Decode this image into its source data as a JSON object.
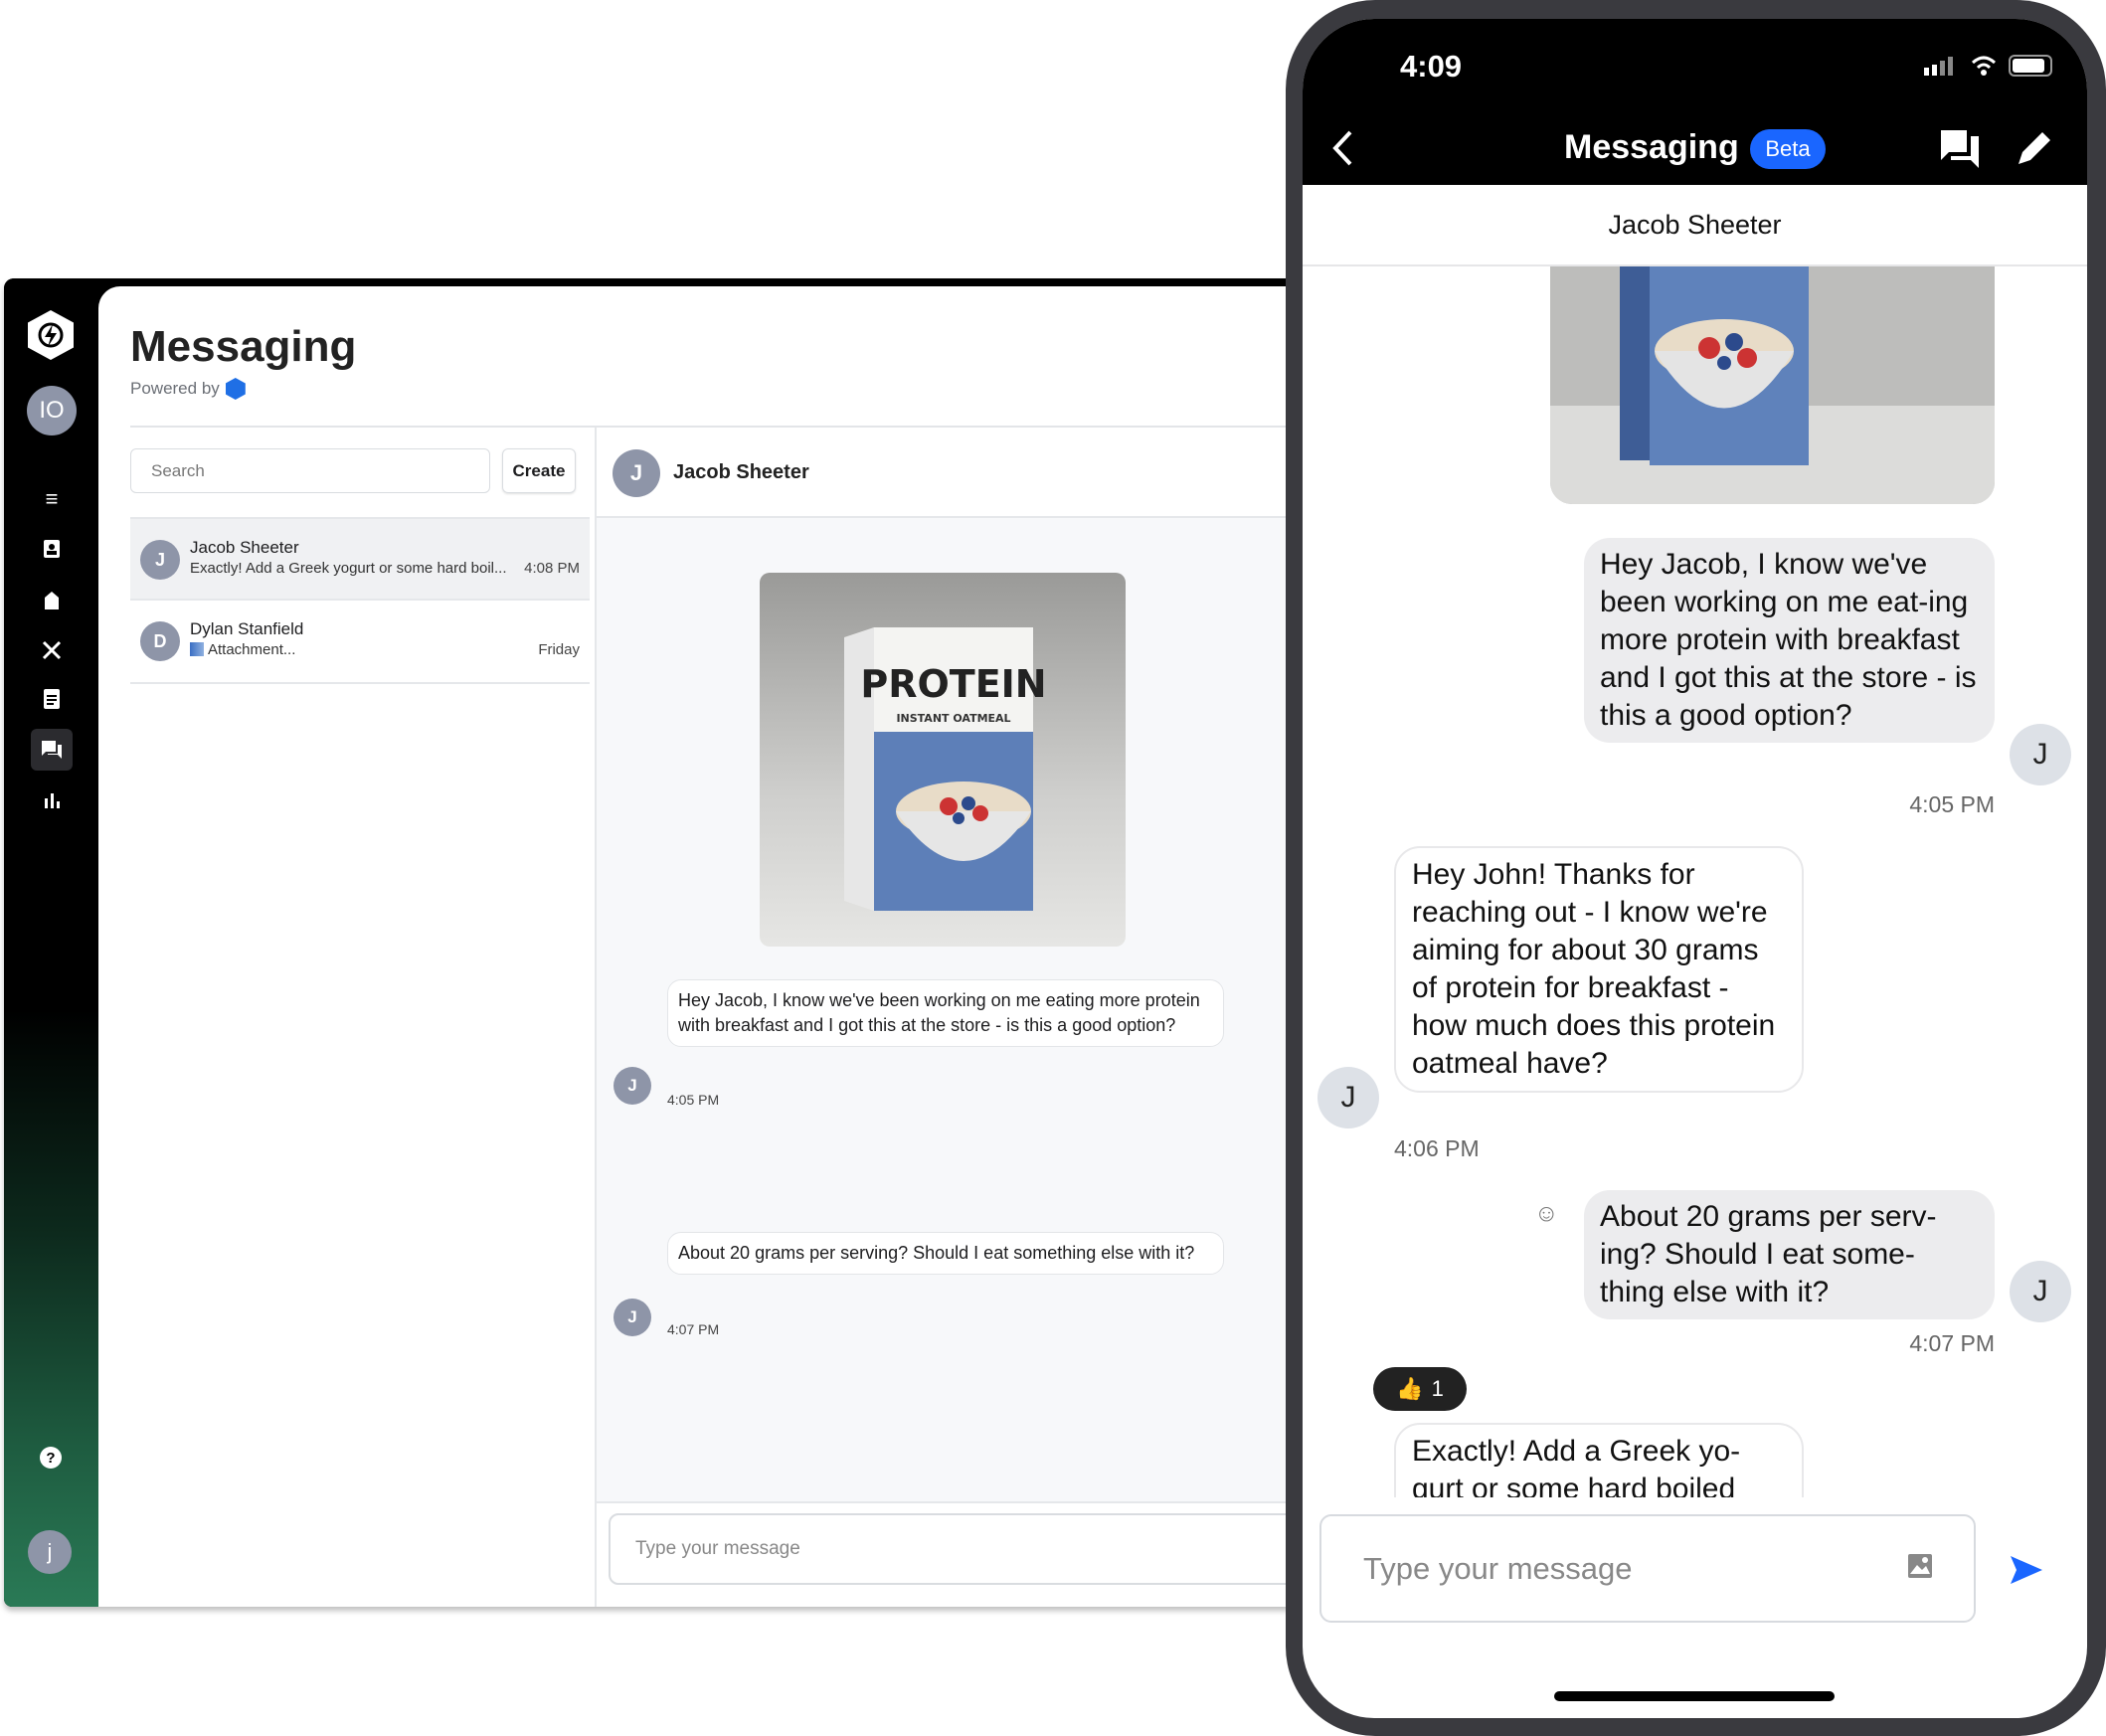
{
  "desktop": {
    "sidebar": {
      "user_initials": "IO",
      "footer_initial": "j",
      "items": [
        {
          "icon": "menu-icon"
        },
        {
          "icon": "contacts-icon"
        },
        {
          "icon": "pantry-icon"
        },
        {
          "icon": "utensils-icon"
        },
        {
          "icon": "clipboard-icon"
        },
        {
          "icon": "messages-icon",
          "active": true
        },
        {
          "icon": "chart-icon"
        }
      ],
      "help_icon": "help-icon"
    },
    "header": {
      "title": "Messaging",
      "powered_by": "Powered by"
    },
    "search": {
      "placeholder": "Search"
    },
    "create_label": "Create",
    "conversations": [
      {
        "initial": "J",
        "name": "Jacob Sheeter",
        "preview": "Exactly! Add a Greek yogurt or some hard boil...",
        "time": "4:08 PM",
        "selected": true
      },
      {
        "initial": "D",
        "name": "Dylan Stanfield",
        "preview": "Attachment...",
        "time": "Friday"
      }
    ],
    "chat": {
      "contact_initial": "J",
      "contact_name": "Jacob Sheeter",
      "image_text": {
        "brand": "PROTEIN",
        "sub": "INSTANT OATMEAL"
      },
      "messages": [
        {
          "initial": "J",
          "text": "Hey Jacob, I know we've been working on me eating more protein with breakfast and I got this at the store - is this a good option?",
          "time": "4:05 PM"
        },
        {
          "initial": "J",
          "text": "About 20 grams per serving? Should I eat something else with it?",
          "time": "4:07 PM"
        }
      ],
      "input_placeholder": "Type your message"
    }
  },
  "phone": {
    "status_time": "4:09",
    "title": "Messaging",
    "badge": "Beta",
    "accent": "#1a66ff",
    "contact_name": "Jacob Sheeter",
    "messages": [
      {
        "from": "me",
        "initial": "J",
        "text": "Hey Jacob, I know we've been working on me eat-ing more protein with breakfast and I got this at the store - is this a good option?",
        "time": "4:05 PM"
      },
      {
        "from": "them",
        "initial": "J",
        "text": "Hey John! Thanks for reaching out - I know we're aiming for about 30 grams of protein for breakfast - how much does this protein oatmeal have?",
        "time": "4:06 PM"
      },
      {
        "from": "me",
        "initial": "J",
        "text": "About 20 grams per serv-ing? Should I eat some-thing else with it?",
        "time": "4:07 PM"
      },
      {
        "from": "them",
        "text": "Exactly! Add a Greek yo-gurt or some hard boiled",
        "reaction": {
          "emoji": "👍",
          "count": "1"
        }
      }
    ],
    "input_placeholder": "Type your message"
  }
}
